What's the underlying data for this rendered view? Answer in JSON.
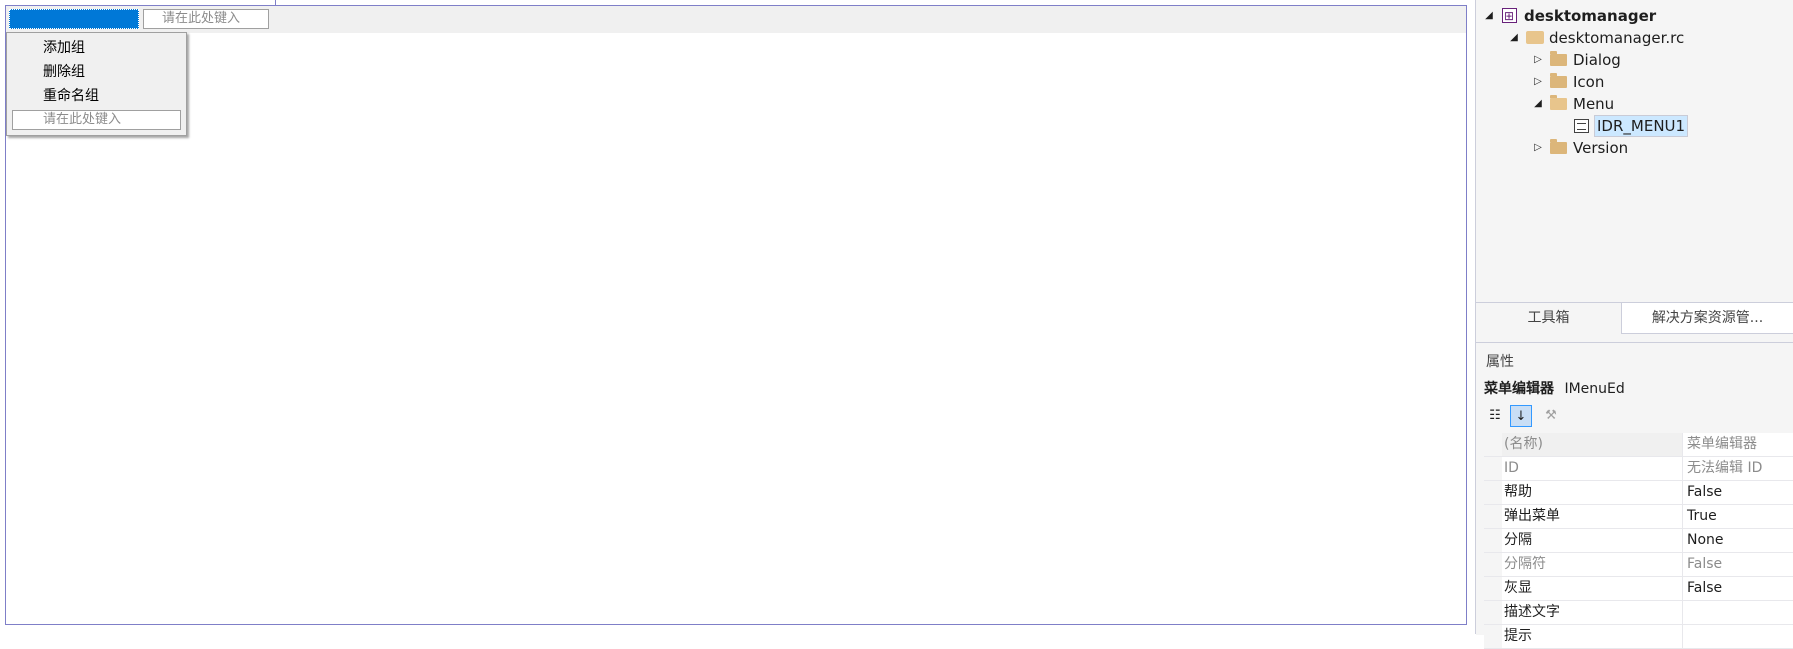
{
  "menu_editor": {
    "menubar_type_here": "请在此处键入",
    "dropdown_items": [
      "添加组",
      "删除组",
      "重命名组"
    ],
    "dropdown_type_here": "请在此处键入"
  },
  "solution_tree": {
    "project": "desktomanager",
    "rc_file": "desktomanager.rc",
    "folders": [
      "Dialog",
      "Icon",
      "Menu",
      "Version"
    ],
    "menu_child": "IDR_MENU1"
  },
  "panel_tabs": [
    "工具箱",
    "解决方案资源管..."
  ],
  "properties": {
    "title": "属性",
    "object_type": "菜单编辑器",
    "object_name": "IMenuEd",
    "rows": [
      {
        "name": "(名称)",
        "value": "菜单编辑器",
        "muted": true
      },
      {
        "name": "ID",
        "value": "无法编辑 ID",
        "muted": true
      },
      {
        "name": "帮助",
        "value": "False",
        "muted": false
      },
      {
        "name": "弹出菜单",
        "value": "True",
        "muted": false
      },
      {
        "name": "分隔",
        "value": "None",
        "muted": false
      },
      {
        "name": "分隔符",
        "value": "False",
        "muted": true
      },
      {
        "name": "灰显",
        "value": "False",
        "muted": false
      },
      {
        "name": "描述文字",
        "value": "",
        "muted": false
      },
      {
        "name": "提示",
        "value": "",
        "muted": false
      }
    ]
  },
  "colors": {
    "selection_blue": "#0078d7",
    "editor_border": "#7f7fc8",
    "folder": "#dcb67a"
  }
}
